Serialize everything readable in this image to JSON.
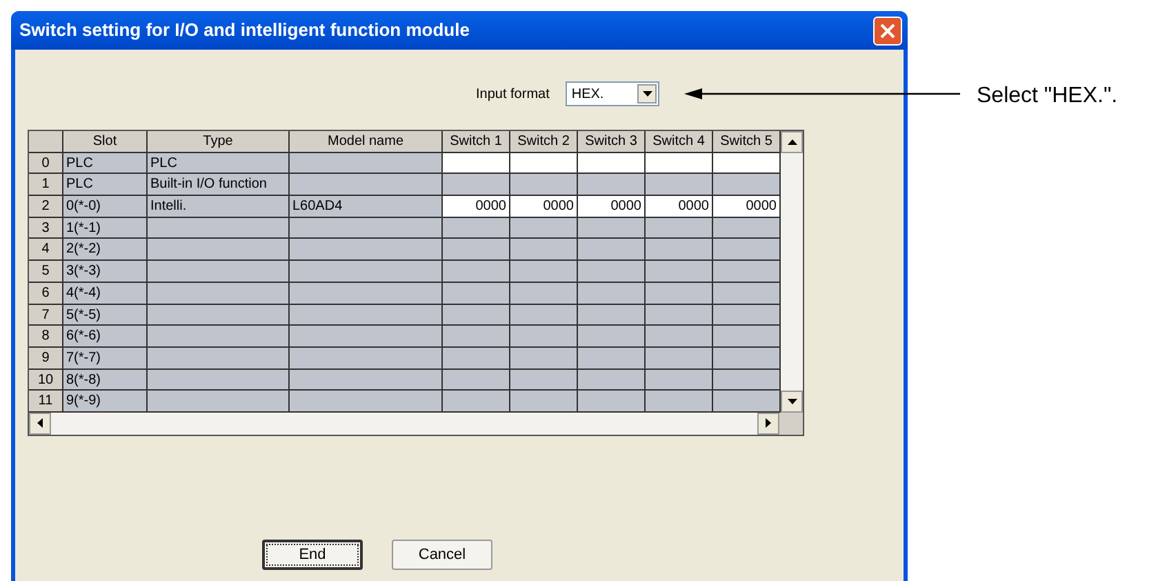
{
  "window": {
    "title": "Switch setting for I/O and intelligent function module"
  },
  "input_format": {
    "label": "Input format",
    "value": "HEX."
  },
  "table": {
    "columns": [
      "Slot",
      "Type",
      "Model name",
      "Switch 1",
      "Switch 2",
      "Switch 3",
      "Switch 4",
      "Switch 5"
    ],
    "rows": [
      {
        "index": "0",
        "slot": "PLC",
        "type": "PLC",
        "editable": true
      },
      {
        "index": "1",
        "slot": "PLC",
        "type": "Built-in I/O function",
        "editable": false
      },
      {
        "index": "2",
        "slot": "0(*-0)",
        "type": "Intelli.",
        "model": "L60AD4",
        "editable": true,
        "switches": [
          "0000",
          "0000",
          "0000",
          "0000",
          "0000"
        ]
      },
      {
        "index": "3",
        "slot": "1(*-1)",
        "editable": false
      },
      {
        "index": "4",
        "slot": "2(*-2)",
        "editable": false
      },
      {
        "index": "5",
        "slot": "3(*-3)",
        "editable": false
      },
      {
        "index": "6",
        "slot": "4(*-4)",
        "editable": false
      },
      {
        "index": "7",
        "slot": "5(*-5)",
        "editable": false
      },
      {
        "index": "8",
        "slot": "6(*-6)",
        "editable": false
      },
      {
        "index": "9",
        "slot": "7(*-7)",
        "editable": false
      },
      {
        "index": "10",
        "slot": "8(*-8)",
        "editable": false
      },
      {
        "index": "11",
        "slot": "9(*-9)",
        "editable": false
      }
    ]
  },
  "buttons": [
    {
      "label": "End",
      "focused": true
    },
    {
      "label": "Cancel",
      "focused": false
    }
  ],
  "callout": {
    "text": "Select \"HEX.\"."
  }
}
